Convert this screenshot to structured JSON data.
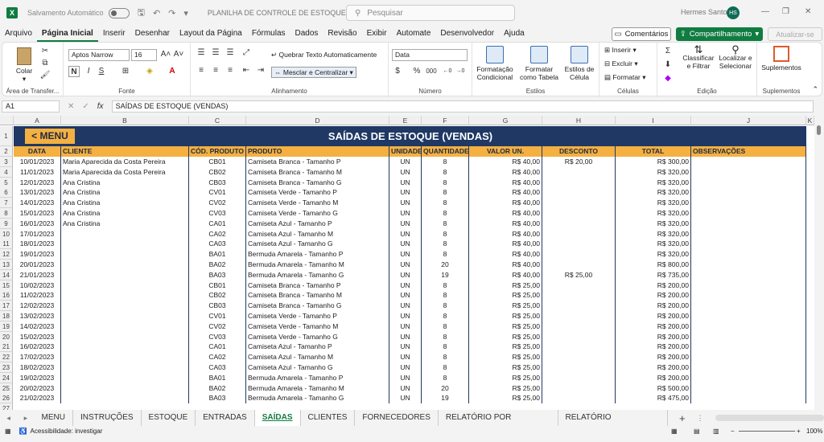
{
  "titlebar": {
    "autosave_label": "Salvamento Automático",
    "filename": "PLANILHA DE CONTROLE DE ESTOQUE.xlsx",
    "search_placeholder": "Pesquisar",
    "user_name": "Hermes Santos",
    "user_initials": "HS"
  },
  "menu": {
    "tabs": [
      "Arquivo",
      "Página Inicial",
      "Inserir",
      "Desenhar",
      "Layout da Página",
      "Fórmulas",
      "Dados",
      "Revisão",
      "Exibir",
      "Automate",
      "Desenvolvedor",
      "Ajuda"
    ],
    "active_tab": "Página Inicial",
    "comments_label": "Comentários",
    "share_label": "Compartilhamento",
    "update_label": "Atualizar-se"
  },
  "ribbon": {
    "paste_label": "Colar",
    "clipboard_label": "Área de Transfer...",
    "font_name": "Aptos Narrow",
    "font_size": "16",
    "font_label": "Fonte",
    "wrap_text_label": "Quebrar Texto Automaticamente",
    "merge_center_label": "Mesclar e Centralizar",
    "alignment_label": "Alinhamento",
    "number_format": "Data",
    "number_label": "Número",
    "conditional_format_label": "Formatação Condicional",
    "format_table_label": "Formatar como Tabela",
    "cell_styles_label": "Estilos de Célula",
    "styles_label": "Estilos",
    "insert_label": "Inserir",
    "delete_label": "Excluir",
    "format_label": "Formatar",
    "cells_label": "Células",
    "sort_filter_label": "Classificar e Filtrar",
    "find_select_label": "Localizar e Selecionar",
    "editing_label": "Edição",
    "addins_label": "Suplementos",
    "addins_group_label": "Suplementos"
  },
  "formula_bar": {
    "cell_ref": "A1",
    "fx": "fx",
    "content": "SAÍDAS DE ESTOQUE (VENDAS)"
  },
  "sheet": {
    "column_letters": [
      "A",
      "B",
      "C",
      "D",
      "E",
      "F",
      "G",
      "H",
      "I",
      "J",
      "K"
    ],
    "title": "SAÍDAS DE ESTOQUE (VENDAS)",
    "menu_button": "< MENU",
    "headers": [
      "DATA",
      "CLIENTE",
      "CÓD. PRODUTO",
      "PRODUTO",
      "UNIDADE",
      "QUANTIDADE",
      "VALOR UN.",
      "DESCONTO",
      "TOTAL",
      "OBSERVAÇÕES"
    ],
    "rows": [
      [
        "10/01/2023",
        "Maria Aparecida da Costa Pereira",
        "CB01",
        "Camiseta Branca - Tamanho P",
        "UN",
        "8",
        "R$ 40,00",
        "R$ 20,00",
        "R$ 300,00"
      ],
      [
        "11/01/2023",
        "Maria Aparecida da Costa Pereira",
        "CB02",
        "Camiseta Branca - Tamanho M",
        "UN",
        "8",
        "R$ 40,00",
        "",
        "R$ 320,00"
      ],
      [
        "12/01/2023",
        "Ana Cristina",
        "CB03",
        "Camiseta Branca - Tamanho G",
        "UN",
        "8",
        "R$ 40,00",
        "",
        "R$ 320,00"
      ],
      [
        "13/01/2023",
        "Ana Cristina",
        "CV01",
        "Camiseta Verde - Tamanho P",
        "UN",
        "8",
        "R$ 40,00",
        "",
        "R$ 320,00"
      ],
      [
        "14/01/2023",
        "Ana Cristina",
        "CV02",
        "Camiseta Verde - Tamanho M",
        "UN",
        "8",
        "R$ 40,00",
        "",
        "R$ 320,00"
      ],
      [
        "15/01/2023",
        "Ana Cristina",
        "CV03",
        "Camiseta Verde - Tamanho G",
        "UN",
        "8",
        "R$ 40,00",
        "",
        "R$ 320,00"
      ],
      [
        "16/01/2023",
        "Ana Cristina",
        "CA01",
        "Camiseta Azul - Tamanho P",
        "UN",
        "8",
        "R$ 40,00",
        "",
        "R$ 320,00"
      ],
      [
        "17/01/2023",
        "",
        "CA02",
        "Camiseta Azul - Tamanho M",
        "UN",
        "8",
        "R$ 40,00",
        "",
        "R$ 320,00"
      ],
      [
        "18/01/2023",
        "",
        "CA03",
        "Camiseta Azul - Tamanho G",
        "UN",
        "8",
        "R$ 40,00",
        "",
        "R$ 320,00"
      ],
      [
        "19/01/2023",
        "",
        "BA01",
        "Bermuda Amarela - Tamanho P",
        "UN",
        "8",
        "R$ 40,00",
        "",
        "R$ 320,00"
      ],
      [
        "20/01/2023",
        "",
        "BA02",
        "Bermuda Amarela - Tamanho M",
        "UN",
        "20",
        "R$ 40,00",
        "",
        "R$ 800,00"
      ],
      [
        "21/01/2023",
        "",
        "BA03",
        "Bermuda Amarela - Tamanho G",
        "UN",
        "19",
        "R$ 40,00",
        "R$ 25,00",
        "R$ 735,00"
      ],
      [
        "10/02/2023",
        "",
        "CB01",
        "Camiseta Branca - Tamanho P",
        "UN",
        "8",
        "R$ 25,00",
        "",
        "R$ 200,00"
      ],
      [
        "11/02/2023",
        "",
        "CB02",
        "Camiseta Branca - Tamanho M",
        "UN",
        "8",
        "R$ 25,00",
        "",
        "R$ 200,00"
      ],
      [
        "12/02/2023",
        "",
        "CB03",
        "Camiseta Branca - Tamanho G",
        "UN",
        "8",
        "R$ 25,00",
        "",
        "R$ 200,00"
      ],
      [
        "13/02/2023",
        "",
        "CV01",
        "Camiseta Verde - Tamanho P",
        "UN",
        "8",
        "R$ 25,00",
        "",
        "R$ 200,00"
      ],
      [
        "14/02/2023",
        "",
        "CV02",
        "Camiseta Verde - Tamanho M",
        "UN",
        "8",
        "R$ 25,00",
        "",
        "R$ 200,00"
      ],
      [
        "15/02/2023",
        "",
        "CV03",
        "Camiseta Verde - Tamanho G",
        "UN",
        "8",
        "R$ 25,00",
        "",
        "R$ 200,00"
      ],
      [
        "16/02/2023",
        "",
        "CA01",
        "Camiseta Azul - Tamanho P",
        "UN",
        "8",
        "R$ 25,00",
        "",
        "R$ 200,00"
      ],
      [
        "17/02/2023",
        "",
        "CA02",
        "Camiseta Azul - Tamanho M",
        "UN",
        "8",
        "R$ 25,00",
        "",
        "R$ 200,00"
      ],
      [
        "18/02/2023",
        "",
        "CA03",
        "Camiseta Azul - Tamanho G",
        "UN",
        "8",
        "R$ 25,00",
        "",
        "R$ 200,00"
      ],
      [
        "19/02/2023",
        "",
        "BA01",
        "Bermuda Amarela - Tamanho P",
        "UN",
        "8",
        "R$ 25,00",
        "",
        "R$ 200,00"
      ],
      [
        "20/02/2023",
        "",
        "BA02",
        "Bermuda Amarela - Tamanho M",
        "UN",
        "20",
        "R$ 25,00",
        "",
        "R$ 500,00"
      ],
      [
        "21/02/2023",
        "",
        "BA03",
        "Bermuda Amarela - Tamanho G",
        "UN",
        "19",
        "R$ 25,00",
        "",
        "R$ 475,00"
      ]
    ]
  },
  "sheet_tabs": {
    "tabs": [
      "MENU",
      "INSTRUÇÕES",
      "ESTOQUE",
      "ENTRADAS",
      "SAÍDAS",
      "CLIENTES",
      "FORNECEDORES",
      "RELATÓRIO POR PRODUTO",
      "RELATÓRIO FINANCEIRO"
    ],
    "active": "SAÍDAS"
  },
  "status": {
    "accessibility": "Acessibilidade: investigar",
    "zoom": "100%"
  },
  "colors": {
    "header_navy": "#1f3864",
    "header_orange": "#f4b041",
    "excel_green": "#107c41"
  }
}
